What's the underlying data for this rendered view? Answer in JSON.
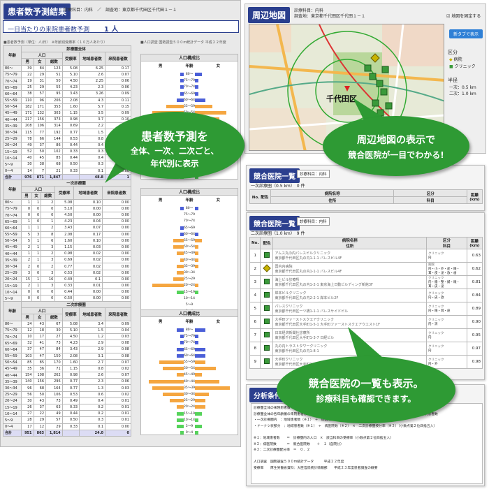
{
  "patients": {
    "title": "患者数予測結果",
    "meta_line1": "診療科目：内科　／　調査地：東京都千代田区千代田１－１",
    "oneday_label": "一日当たりの来院患者数予測",
    "oneday_value": "1 人",
    "note_left": "■患者数予測（単位：人/日）　※年齢別受療率（１０万人あたり）",
    "note_right": "■人口調査 国勢調査５００m統計データ 平成２２年度",
    "tables": [
      {
        "title": "診療圏全体",
        "h_pop": "人口",
        "h_male": "男",
        "h_female": "女",
        "h_total": "総数",
        "h_rate": "受療率",
        "h_local": "地域患者数",
        "h_visit": "来院患者数",
        "h_age": "年齢",
        "pyr_title": "人口構成比",
        "pyr_m": "男",
        "pyr_f": "女",
        "pyr_age": "年齢",
        "rows": [
          [
            "80～",
            "39",
            "84",
            "123",
            "5.08",
            "6.25",
            "0.17"
          ],
          [
            "75～79",
            "22",
            "29",
            "51",
            "5.10",
            "2.6",
            "0.07"
          ],
          [
            "70～74",
            "19",
            "31",
            "50",
            "4.50",
            "2.25",
            "0.06"
          ],
          [
            "65～69",
            "25",
            "29",
            "55",
            "4.23",
            "2.3",
            "0.06"
          ],
          [
            "60～64",
            "38",
            "57",
            "95",
            "3.43",
            "3.26",
            "0.09"
          ],
          [
            "55～59",
            "110",
            "96",
            "206",
            "2.08",
            "4.3",
            "0.11"
          ],
          [
            "50～54",
            "182",
            "171",
            "353",
            "1.60",
            "5.7",
            "0.15"
          ],
          [
            "45～49",
            "171",
            "132",
            "303",
            "1.15",
            "3.5",
            "0.09"
          ],
          [
            "40～44",
            "217",
            "156",
            "373",
            "0.98",
            "3.7",
            "0.10"
          ],
          [
            "35～39",
            "208",
            "106",
            "314",
            "0.69",
            "2.2",
            "0.06"
          ],
          [
            "30～34",
            "115",
            "77",
            "192",
            "0.77",
            "1.5",
            "0.04"
          ],
          [
            "25～29",
            "78",
            "66",
            "144",
            "0.53",
            "0.8",
            "0.02"
          ],
          [
            "20～24",
            "49",
            "37",
            "86",
            "0.44",
            "0.4",
            "0.01"
          ],
          [
            "15～19",
            "52",
            "50",
            "102",
            "0.33",
            "0.3",
            "0.01"
          ],
          [
            "10～14",
            "40",
            "45",
            "85",
            "0.44",
            "0.4",
            "0.01"
          ],
          [
            "5～9",
            "30",
            "38",
            "68",
            "0.50",
            "0.3",
            "0.01"
          ],
          [
            "0～4",
            "14",
            "7",
            "21",
            "0.33",
            "0.1",
            "0.00"
          ],
          [
            "合計",
            "976",
            "871",
            "1,847",
            "",
            "48.8",
            "1"
          ]
        ],
        "pyr": [
          [
            1,
            2
          ],
          [
            1,
            1
          ],
          [
            1,
            1
          ],
          [
            1,
            1
          ],
          [
            2,
            3
          ],
          [
            5,
            5
          ],
          [
            9,
            9
          ],
          [
            9,
            7
          ],
          [
            11,
            8
          ],
          [
            11,
            5
          ],
          [
            6,
            4
          ],
          [
            4,
            3
          ],
          [
            2,
            2
          ],
          [
            3,
            3
          ],
          [
            2,
            2
          ],
          [
            2,
            2
          ],
          [
            1,
            1
          ]
        ]
      },
      {
        "title": "一次診療圏",
        "h_pop": "人口",
        "h_male": "男",
        "h_female": "女",
        "h_total": "総数",
        "h_rate": "受療率",
        "h_local": "地域患者数",
        "h_visit": "来院患者数",
        "h_age": "年齢",
        "pyr_title": "人口構成比",
        "pyr_m": "男",
        "pyr_f": "女",
        "pyr_age": "年齢",
        "rows": [
          [
            "80～",
            "1",
            "1",
            "2",
            "5.08",
            "0.10",
            "0.00"
          ],
          [
            "75～79",
            "0",
            "0",
            "0",
            "5.10",
            "0.00",
            "0.00"
          ],
          [
            "70～74",
            "0",
            "0",
            "0",
            "4.50",
            "0.00",
            "0.00"
          ],
          [
            "65～69",
            "1",
            "0",
            "1",
            "4.23",
            "0.04",
            "0.00"
          ],
          [
            "60～64",
            "1",
            "1",
            "2",
            "3.43",
            "0.07",
            "0.00"
          ],
          [
            "55～59",
            "5",
            "3",
            "8",
            "2.08",
            "0.17",
            "0.00"
          ],
          [
            "50～54",
            "5",
            "1",
            "6",
            "1.60",
            "0.10",
            "0.00"
          ],
          [
            "45～49",
            "2",
            "1",
            "3",
            "1.15",
            "0.03",
            "0.00"
          ],
          [
            "40～44",
            "1",
            "1",
            "2",
            "0.98",
            "0.02",
            "0.00"
          ],
          [
            "35～39",
            "2",
            "1",
            "3",
            "0.69",
            "0.02",
            "0.00"
          ],
          [
            "30～34",
            "2",
            "0",
            "2",
            "0.77",
            "0.02",
            "0.00"
          ],
          [
            "25～29",
            "3",
            "0",
            "3",
            "0.53",
            "0.02",
            "0.00"
          ],
          [
            "20～24",
            "15",
            "1",
            "16",
            "0.49",
            "0.1",
            "0.00"
          ],
          [
            "15～19",
            "2",
            "1",
            "3",
            "0.33",
            "0.01",
            "0.00"
          ],
          [
            "10～14",
            "0",
            "0",
            "0",
            "0.44",
            "0.00",
            "0.00"
          ],
          [
            "5～9",
            "0",
            "0",
            "0",
            "0.50",
            "0.00",
            "0.00"
          ],
          [
            "0～4",
            "0",
            "0",
            "0",
            "0.33",
            "0.00",
            "0.00"
          ],
          [
            "合計",
            "25",
            "8",
            "33",
            "",
            "0.6",
            "0"
          ]
        ],
        "pyr": [
          [
            1,
            1
          ],
          [
            0,
            0
          ],
          [
            0,
            0
          ],
          [
            1,
            0
          ],
          [
            1,
            1
          ],
          [
            3,
            2
          ],
          [
            3,
            1
          ],
          [
            2,
            1
          ],
          [
            1,
            1
          ],
          [
            2,
            1
          ],
          [
            2,
            0
          ],
          [
            3,
            0
          ],
          [
            9,
            1
          ],
          [
            2,
            1
          ],
          [
            0,
            0
          ],
          [
            0,
            0
          ],
          [
            0,
            0
          ]
        ]
      },
      {
        "title": "二次診療圏",
        "h_pop": "人口",
        "h_male": "男",
        "h_female": "女",
        "h_total": "総数",
        "h_rate": "受療率",
        "h_local": "地域患者数",
        "h_visit": "来院患者数",
        "h_age": "年齢",
        "pyr_title": "人口構成比",
        "pyr_m": "男",
        "pyr_f": "女",
        "pyr_age": "年齢",
        "rows": [
          [
            "80～",
            "24",
            "43",
            "67",
            "5.08",
            "3.4",
            "0.09"
          ],
          [
            "75～79",
            "12",
            "18",
            "30",
            "5.10",
            "1.5",
            "0.04"
          ],
          [
            "70～74",
            "10",
            "17",
            "27",
            "4.50",
            "1.2",
            "0.03"
          ],
          [
            "65～69",
            "32",
            "41",
            "73",
            "4.23",
            "2.9",
            "0.08"
          ],
          [
            "60～64",
            "37",
            "47",
            "84",
            "3.43",
            "2.9",
            "0.08"
          ],
          [
            "55～59",
            "103",
            "47",
            "150",
            "2.08",
            "3.1",
            "0.08"
          ],
          [
            "50～54",
            "85",
            "85",
            "170",
            "1.60",
            "2.7",
            "0.07"
          ],
          [
            "45～49",
            "35",
            "36",
            "71",
            "1.15",
            "0.8",
            "0.02"
          ],
          [
            "40～44",
            "154",
            "108",
            "262",
            "0.98",
            "2.6",
            "0.07"
          ],
          [
            "35～39",
            "140",
            "156",
            "296",
            "0.77",
            "2.3",
            "0.06"
          ],
          [
            "30～34",
            "96",
            "68",
            "164",
            "0.77",
            "1.3",
            "0.03"
          ],
          [
            "25～29",
            "56",
            "50",
            "106",
            "0.53",
            "0.6",
            "0.02"
          ],
          [
            "20～24",
            "30",
            "43",
            "73",
            "0.49",
            "0.4",
            "0.01"
          ],
          [
            "15～19",
            "26",
            "37",
            "63",
            "0.33",
            "0.2",
            "0.01"
          ],
          [
            "10～14",
            "27",
            "22",
            "49",
            "0.44",
            "0.2",
            "0.01"
          ],
          [
            "5～9",
            "28",
            "29",
            "57",
            "0.50",
            "0.3",
            "0.01"
          ],
          [
            "0～4",
            "17",
            "12",
            "29",
            "0.33",
            "0.1",
            "0.00"
          ],
          [
            "合計",
            "951",
            "863",
            "1,814",
            "",
            "24.0",
            "0"
          ]
        ],
        "pyr": [
          [
            2,
            3
          ],
          [
            1,
            1
          ],
          [
            1,
            1
          ],
          [
            2,
            3
          ],
          [
            2,
            3
          ],
          [
            7,
            3
          ],
          [
            6,
            6
          ],
          [
            2,
            2
          ],
          [
            10,
            7
          ],
          [
            9,
            10
          ],
          [
            6,
            4
          ],
          [
            4,
            3
          ],
          [
            2,
            3
          ],
          [
            2,
            2
          ],
          [
            2,
            1
          ],
          [
            2,
            2
          ],
          [
            1,
            1
          ]
        ]
      }
    ]
  },
  "map_panel": {
    "title": "周辺地図",
    "meta_line1": "診療科目：内科",
    "meta_line2": "調査地：東京都千代田区千代田１－１",
    "fix_checkbox_label": "地図を固定する",
    "new_tab_button": "新タブで表示",
    "legend_title": "区分",
    "legend_hospital": "病院",
    "legend_clinic": "クリニック",
    "radius_title": "半径",
    "radius_primary": "一次：0.5 km",
    "radius_secondary": "二次：1.0 km",
    "place_label": "千代田区"
  },
  "comp1": {
    "title": "競合医院一覧",
    "tag": "診療科目：内科",
    "sub": "一次診療圏（0.5 km）　0 件",
    "h_no": "No.",
    "h_color": "配色",
    "h_name": "病院名称",
    "h_addr": "住所",
    "h_kubun": "区分",
    "h_kamoku": "科目",
    "h_dist": "距離 (km)"
  },
  "comp2": {
    "title": "競合医院一覧",
    "tag": "診療科目：内科",
    "sub": "二次診療圏（1.0 km）　9 件",
    "h_no": "No.",
    "h_color": "配色",
    "h_name": "病院名称",
    "h_addr": "住所",
    "h_kubun": "区分",
    "h_kamoku": "科目",
    "h_dist": "距離 (km)",
    "rows": [
      {
        "no": "1",
        "kind": "clinic",
        "name": "アムス丸の内パレスビルクリニック",
        "addr": "東京都千代田区丸の内1-1-1 パレスビル4F",
        "kubun": "クリニック",
        "kamoku": "内",
        "dist": "0.63"
      },
      {
        "no": "2",
        "kind": "hospital",
        "name": "国内内病院",
        "addr": "東京都千代田区丸の内1-1-1 パレスビル4F",
        "kubun": "病院",
        "kamoku": "内・小・外・産・眼・耳・皮・泌・放・歯",
        "dist": "0.62"
      },
      {
        "no": "3",
        "kind": "clinic",
        "name": "海上ビル診療所",
        "addr": "東京都千代田区丸の内1-2-1 東京海上日動ビルディング新館3F",
        "kubun": "クリニック",
        "kamoku": "内・循・整・婦・眼・耳・皮・泌",
        "dist": "0.81"
      },
      {
        "no": "4",
        "kind": "clinic",
        "name": "岸本ビルクリニック",
        "addr": "東京都千代田区丸の内2-2-1 岸本ビル2F",
        "kubun": "クリニック",
        "kamoku": "内・皮・放",
        "dist": "0.84"
      },
      {
        "no": "5",
        "kind": "clinic",
        "name": "パレスクリニック",
        "addr": "東京都千代田区一ツ橋1-1-1 パレスサイドビル",
        "kubun": "クリニック",
        "kamoku": "内・眼・耳・皮",
        "dist": "0.89"
      },
      {
        "no": "6",
        "kind": "clinic",
        "name": "大手町ファーストスクエアクリニック",
        "addr": "東京都千代田区大手町1-5-1 大手町ファーストスクエアウエスト1F",
        "kubun": "クリニック",
        "kamoku": "内・消",
        "dist": "0.90"
      },
      {
        "no": "7",
        "kind": "clinic",
        "name": "日本経済新聞社診療所",
        "addr": "東京都千代田区大手町1-3-7 日経ビル",
        "kubun": "クリニック",
        "kamoku": "内",
        "dist": "0.95"
      },
      {
        "no": "8",
        "kind": "clinic",
        "name": "丸の内トラストタワークリニック",
        "addr": "東京都千代田区丸の内1-8-1",
        "kubun": "クリニック",
        "kamoku": "内",
        "dist": "0.97"
      },
      {
        "no": "9",
        "kind": "clinic",
        "name": "大手町クリニック",
        "addr": "東京都千代田区大手町1-6-1",
        "kubun": "クリニック",
        "kamoku": "内・外",
        "dist": "0.98"
      }
    ]
  },
  "analysis": {
    "title": "分析条件",
    "lines": [
      "診療圏全体の来院患者数　＝　診療圏全体の来院患者数（小数点第２位四捨五入）",
      "診療圏全体の各年齢層の来院患者数　＝　一次診療圏内の来院患者数　＋　二次診療圏内（ドーナツ状部分）の来院患者数",
      "・一次診療圏内　：地域患者数（※１）　÷　病医院数（※２）（小数点第２位四捨五入）",
      "・ドーナツ状部分　：地域患者数（※１）　÷　病医院数（※２）　×　二次診療圏按分率（※３）（小数点第２位四捨五入）",
      "",
      "※１：地域患者数　　＝　診療圏内の人口　×　該当科目の受療率（小数点第２位四捨五入）",
      "※２：病医院数　　　＝　競合医院数　　＋　１（自院分）",
      "※３：二次診療圏配分率　＝　０．２",
      "",
      "人口調査　国勢調査５００m統計データ　　　平成２２年度",
      "受療率　　厚生労働省資料：大臣官房統計情報部　　平成２３年度患者調査の概要"
    ]
  },
  "callouts": {
    "left_l1": "患者数予測を",
    "left_l2": "全体、一次、二次ごと、",
    "left_l3": "年代別に表示",
    "map_l1": "周辺地図の表示で",
    "map_l2": "競合医院が一目でわかる!",
    "list_l1": "競合医院の一覧も表示。",
    "list_l2": "診療科目も確認できます。"
  }
}
